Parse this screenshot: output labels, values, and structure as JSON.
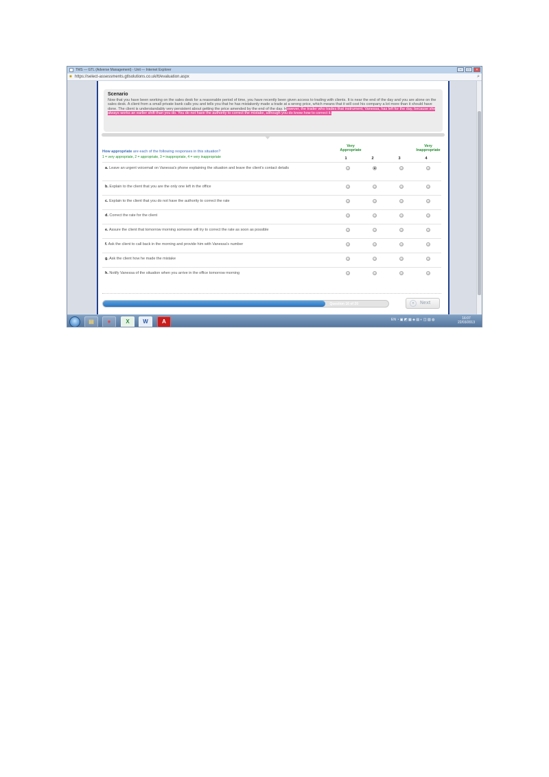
{
  "window": {
    "title": "TMS — GTL (Adverse Management) - Unit — Internet Explorer",
    "url": "https://select-assessments.gtlsolutions.co.uk/tt/evaluation.aspx"
  },
  "scenario": {
    "heading": "Scenario",
    "text_plain": "Now that you have been working on the sales desk for a reasonable period of time, you have recently been given access to trading with clients. It is near the end of the day and you are alone on the sales desk. A client from a small private bank calls you and tells you that he has mistakenly made a trade at a wrong price, which means that it will cost his company a lot more than it should have done. The client is understandably very persistent about getting the price amended by the end of the day. H",
    "text_highlight": "owever, the trader who trades that instrument, Vanessa, has left for the day, because she always works an earlier shift than you do. You do not have the authority to correct the mistake, although you do know how to correct it."
  },
  "question": {
    "prefix": "How appropriate",
    "suffix": " are each of the following responses in this situation?",
    "scale": "1 = very appropriate, 2 = appropriate, 3 = inappropriate, 4 = very inappropriate"
  },
  "columns": {
    "left_label": "Very Appropriate",
    "right_label": "Very Inappropriate",
    "numbers": [
      "1",
      "2",
      "3",
      "4"
    ]
  },
  "responses": [
    {
      "letter": "a.",
      "text": "Leave an urgent voicemail on Vanessa's phone explaining the situation and leave the client's contact details",
      "selected": 2
    },
    {
      "letter": "b.",
      "text": "Explain to the client that you are the only one left in the office",
      "selected": 0
    },
    {
      "letter": "c.",
      "text": "Explain to the client that you do not have the authority to correct the rate",
      "selected": 0
    },
    {
      "letter": "d.",
      "text": "Correct the rate for the client",
      "selected": 0
    },
    {
      "letter": "e.",
      "text": "Assure the client that tomorrow morning someone will try to correct the rate as soon as possible",
      "selected": 0
    },
    {
      "letter": "f.",
      "text": "Ask the client to call back in the morning and provide him with Vanessa's number",
      "selected": 0
    },
    {
      "letter": "g.",
      "text": "Ask the client how he made the mistake",
      "selected": 0
    },
    {
      "letter": "h.",
      "text": "Notify Vanessa of the situation when you arrive in the office tomorrow morning",
      "selected": 0
    }
  ],
  "progress": {
    "label": "Question 16 of 20",
    "fraction": 0.78
  },
  "next_label": "Next",
  "taskbar": {
    "tray_text": "EN",
    "time": "16:07",
    "date": "22/03/2013",
    "apps": [
      "explorer-icon",
      "chrome-icon",
      "excel-icon",
      "word-icon",
      "acrobat-icon"
    ]
  },
  "colors": {
    "highlight": "#e8509a",
    "question_blue": "#3a6cb5",
    "scale_green": "#1e8c2c",
    "page_border": "#1f3f8f"
  }
}
